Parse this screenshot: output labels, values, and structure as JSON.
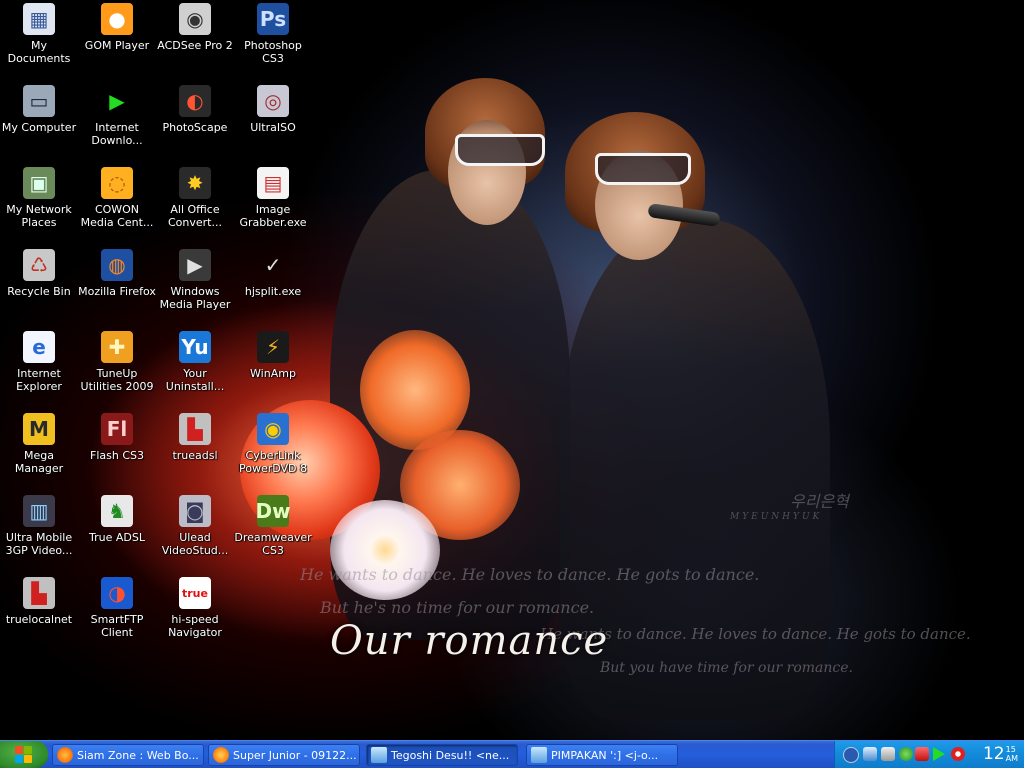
{
  "desktop": {
    "icons": [
      {
        "label": "My Documents",
        "icon": "my-documents-icon",
        "glyph": "▦",
        "color": "#dfe6f2",
        "fg": "#3a5a9a"
      },
      {
        "label": "GOM Player",
        "icon": "gom-player-icon",
        "glyph": "●",
        "color": "#ff9a1a",
        "fg": "#fff"
      },
      {
        "label": "ACDSee Pro 2",
        "icon": "acdsee-icon",
        "glyph": "◉",
        "color": "#d0d0d0",
        "fg": "#333"
      },
      {
        "label": "Photoshop CS3",
        "icon": "photoshop-icon",
        "glyph": "Ps",
        "color": "#1f4f9f",
        "fg": "#cfe0ff"
      },
      {
        "label": "My Computer",
        "icon": "my-computer-icon",
        "glyph": "▭",
        "color": "#9aa8b8",
        "fg": "#1a2a40"
      },
      {
        "label": "Internet Downlo...",
        "icon": "internet-download-manager-icon",
        "glyph": "▶",
        "color": "#000",
        "fg": "#22dd22"
      },
      {
        "label": "PhotoScape",
        "icon": "photoscape-icon",
        "glyph": "◐",
        "color": "#2a2a2a",
        "fg": "#ff5533"
      },
      {
        "label": "UltraISO",
        "icon": "ultraiso-icon",
        "glyph": "◎",
        "color": "#c8c8d4",
        "fg": "#a03030"
      },
      {
        "label": "My Network Places",
        "icon": "network-places-icon",
        "glyph": "▣",
        "color": "#6a8a5a",
        "fg": "#dfe"
      },
      {
        "label": "COWON Media Cent...",
        "icon": "cowon-icon",
        "glyph": "◌",
        "color": "#ffb020",
        "fg": "#b05000"
      },
      {
        "label": "All Office Convert...",
        "icon": "office-converter-icon",
        "glyph": "✸",
        "color": "#2a2a2a",
        "fg": "#ffcc22"
      },
      {
        "label": "Image Grabber.exe",
        "icon": "image-grabber-icon",
        "glyph": "▤",
        "color": "#f4f4f4",
        "fg": "#d03030"
      },
      {
        "label": "Recycle Bin",
        "icon": "recycle-bin-icon",
        "glyph": "♺",
        "color": "#c8c8c8",
        "fg": "#c03020"
      },
      {
        "label": "Mozilla Firefox",
        "icon": "firefox-icon",
        "glyph": "◍",
        "color": "#1e4fa0",
        "fg": "#ff8a1a"
      },
      {
        "label": "Windows Media Player",
        "icon": "windows-media-player-icon",
        "glyph": "▶",
        "color": "#3a3a3a",
        "fg": "#e0e0e0"
      },
      {
        "label": "hjsplit.exe",
        "icon": "hjsplit-icon",
        "glyph": "✓",
        "color": "transparent",
        "fg": "#e0e0e0"
      },
      {
        "label": "Internet Explorer",
        "icon": "internet-explorer-icon",
        "glyph": "e",
        "color": "#f2f6ff",
        "fg": "#2a6ad8"
      },
      {
        "label": "TuneUp Utilities 2009",
        "icon": "tuneup-icon",
        "glyph": "✚",
        "color": "#f0a020",
        "fg": "#fff6c0"
      },
      {
        "label": "Your Uninstall...",
        "icon": "your-uninstaller-icon",
        "glyph": "Yu",
        "color": "#1a78d8",
        "fg": "#fff"
      },
      {
        "label": "WinAmp",
        "icon": "winamp-icon",
        "glyph": "⚡",
        "color": "#1a1a1a",
        "fg": "#f0b020"
      },
      {
        "label": "Mega Manager",
        "icon": "mega-manager-icon",
        "glyph": "M",
        "color": "#f0c020",
        "fg": "#2a2a2a"
      },
      {
        "label": "Flash CS3",
        "icon": "flash-icon",
        "glyph": "Fl",
        "color": "#8a1a1a",
        "fg": "#ffd0d0"
      },
      {
        "label": "trueadsl",
        "icon": "trueadsl-icon",
        "glyph": "▙",
        "color": "#c0c0c0",
        "fg": "#d02020"
      },
      {
        "label": "CyberLink PowerDVD 8",
        "icon": "powerdvd-icon",
        "glyph": "◉",
        "color": "#2a70d0",
        "fg": "#ffcc00"
      },
      {
        "label": "Ultra Mobile 3GP Video...",
        "icon": "ultra-mobile-3gp-icon",
        "glyph": "▥",
        "color": "#3a3a4a",
        "fg": "#8ad0ff"
      },
      {
        "label": "True ADSL",
        "icon": "true-adsl-icon",
        "glyph": "♞",
        "color": "#e8e8e8",
        "fg": "#228a22"
      },
      {
        "label": "Ulead VideoStud...",
        "icon": "ulead-videostudio-icon",
        "glyph": "◙",
        "color": "#bcbcc8",
        "fg": "#3a3a5a"
      },
      {
        "label": "Dreamweaver CS3",
        "icon": "dreamweaver-icon",
        "glyph": "Dw",
        "color": "#4a7a1a",
        "fg": "#e0ffc0"
      },
      {
        "label": "truelocalnet",
        "icon": "truelocalnet-icon",
        "glyph": "▙",
        "color": "#c0c0c0",
        "fg": "#d02020"
      },
      {
        "label": "SmartFTP Client",
        "icon": "smartftp-icon",
        "glyph": "◑",
        "color": "#1a5ad0",
        "fg": "#ff5030"
      },
      {
        "label": "hi-speed Navigator",
        "icon": "hi-speed-navigator-icon",
        "glyph": "true",
        "color": "#ffffff",
        "fg": "#e01010"
      }
    ]
  },
  "wallpaper": {
    "title": "Our romance",
    "watermark": "우리은혁",
    "watermark_sub": "MYEUNHYUK",
    "lyric_1": "He wants to dance. He loves to dance. He gots to dance.",
    "lyric_2": "But he's no time for our romance.",
    "lyric_3": "He wants to dance. He loves to dance. He gots to dance.",
    "lyric_4": "But you have time for our romance."
  },
  "taskbar": {
    "tasks": [
      {
        "label": "Siam Zone : Web Bo...",
        "icon": "firefox-icon",
        "color": "#ff8a1a",
        "active": false
      },
      {
        "label": "Super Junior - 09122...",
        "icon": "firefox-icon",
        "color": "#ffa020",
        "active": false
      },
      {
        "label": "Tegoshi Desu!! <ne...",
        "icon": "messenger-window-icon",
        "color": "#8ad0ff",
        "active": true
      },
      {
        "label": "PIMPAKAN  ':]  <j-o...",
        "icon": "messenger-window-icon",
        "color": "#8ad0ff",
        "active": false
      }
    ],
    "clock": {
      "time": "12",
      "hour_suffix_top": "15",
      "hour_suffix_bottom": "AM"
    }
  }
}
